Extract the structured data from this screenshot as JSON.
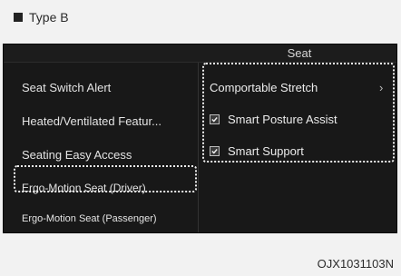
{
  "figure": {
    "type_label": "Type B",
    "code": "OJX1031103N"
  },
  "screen": {
    "header_title": "Seat",
    "left_menu": [
      {
        "label": "Seat Switch Alert"
      },
      {
        "label": "Heated/Ventilated Featur..."
      },
      {
        "label": "Seating Easy Access"
      },
      {
        "label": "Ergo-Motion Seat (Driver)"
      },
      {
        "label": "Ergo-Motion Seat (Passenger)"
      }
    ],
    "options": [
      {
        "label": "Comportable Stretch",
        "icon": "chevron-right-icon",
        "chevron": "›"
      },
      {
        "label": "Smart Posture Assist",
        "icon": "checkbox-icon",
        "checked": true
      },
      {
        "label": "Smart Support",
        "icon": "checkbox-icon",
        "checked": true
      }
    ]
  }
}
